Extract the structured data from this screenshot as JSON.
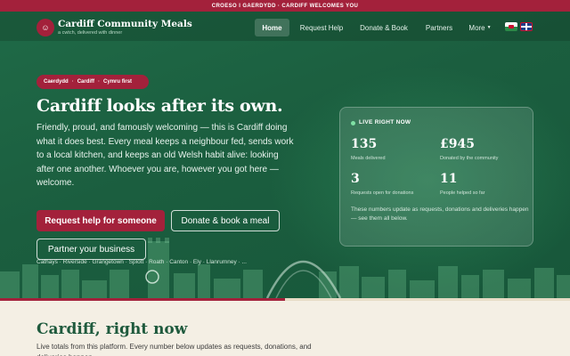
{
  "topbar": {
    "text": "CROESO I GAERDYDD · CARDIFF WELCOMES YOU"
  },
  "brand": {
    "name": "Cardiff Community Meals",
    "tagline": "a cwtch, delivered with dinner",
    "logo_icon": "smile-icon"
  },
  "nav": {
    "items": [
      "Home",
      "Request Help",
      "Donate & Book",
      "Partners",
      "More"
    ],
    "active": "Home",
    "languages": [
      "Cymraeg",
      "English"
    ]
  },
  "hero": {
    "tags": [
      "Caerdydd",
      "Cardiff",
      "Cymru first"
    ],
    "headline": "Cardiff looks after its own.",
    "intro": "Friendly, proud, and famously welcoming — this is Cardiff doing what it does best. Every meal keeps a neighbour fed, sends work to a local kitchen, and keeps an old Welsh habit alive: looking after one another. Whoever you are, however you got here — welcome.",
    "buttons": {
      "request": "Request help for someone",
      "donate": "Donate & book a meal",
      "partner": "Partner your business"
    },
    "areas": "Cathays · Riverside · Grangetown · Splott · Roath · Canton · Ely · Llanrumney · ..."
  },
  "live": {
    "title": "LIVE RIGHT NOW",
    "stats": [
      {
        "value": "135",
        "label": "Meals delivered"
      },
      {
        "value": "£945",
        "label": "Donated by the community"
      },
      {
        "value": "3",
        "label": "Requests open for donations"
      },
      {
        "value": "11",
        "label": "People helped so far"
      }
    ],
    "note": "These numbers update as requests, donations and deliveries happen — see them all below."
  },
  "section": {
    "title": "Cardiff, right now",
    "text": "Live totals from this platform. Every number below updates as requests, donations, and deliveries happen."
  },
  "colors": {
    "brand_red": "#a3213b",
    "hero_green": "#1b5e3f",
    "cream": "#f4efe4"
  }
}
